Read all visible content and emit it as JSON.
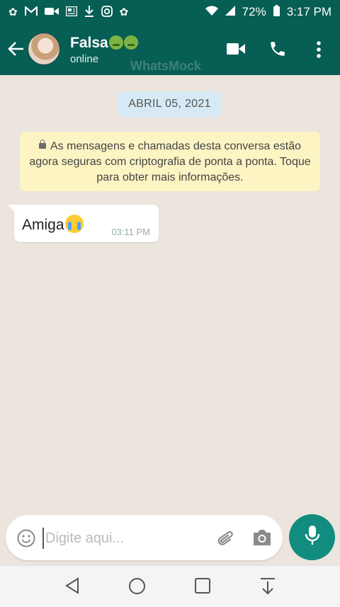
{
  "status_bar": {
    "battery": "72%",
    "time": "3:17 PM"
  },
  "header": {
    "contact_name": "Falsa",
    "contact_status": "online",
    "watermark": "WhatsMock"
  },
  "chat": {
    "date_chip": "ABRIL 05, 2021",
    "encryption_notice": "As mensagens e chamadas desta conversa estão agora seguras com criptografia de ponta a ponta. Toque para obter mais informações.",
    "messages": [
      {
        "text": "Amiga",
        "time": "03:11 PM",
        "direction": "incoming"
      }
    ]
  },
  "composer": {
    "placeholder": "Digite aqui...",
    "value": ""
  },
  "colors": {
    "header": "#075e54",
    "accent": "#128c7e",
    "chat_background": "#ece5dd",
    "notice_background": "#fdf4c4",
    "date_chip_background": "#d6e9f4"
  },
  "icons": {
    "status_left": [
      "app-notification-icon",
      "gmail-icon",
      "video-icon",
      "news-icon",
      "download-icon",
      "instagram-icon",
      "app-notification-icon"
    ],
    "status_right": [
      "wifi-icon",
      "signal-icon",
      "battery-icon"
    ],
    "header": [
      "back-arrow-icon",
      "video-call-icon",
      "phone-icon",
      "more-vertical-icon"
    ],
    "composer": [
      "emoji-icon",
      "attach-icon",
      "camera-icon",
      "mic-icon"
    ],
    "nav": [
      "back-triangle-icon",
      "home-circle-icon",
      "recents-square-icon",
      "pull-down-icon"
    ]
  }
}
